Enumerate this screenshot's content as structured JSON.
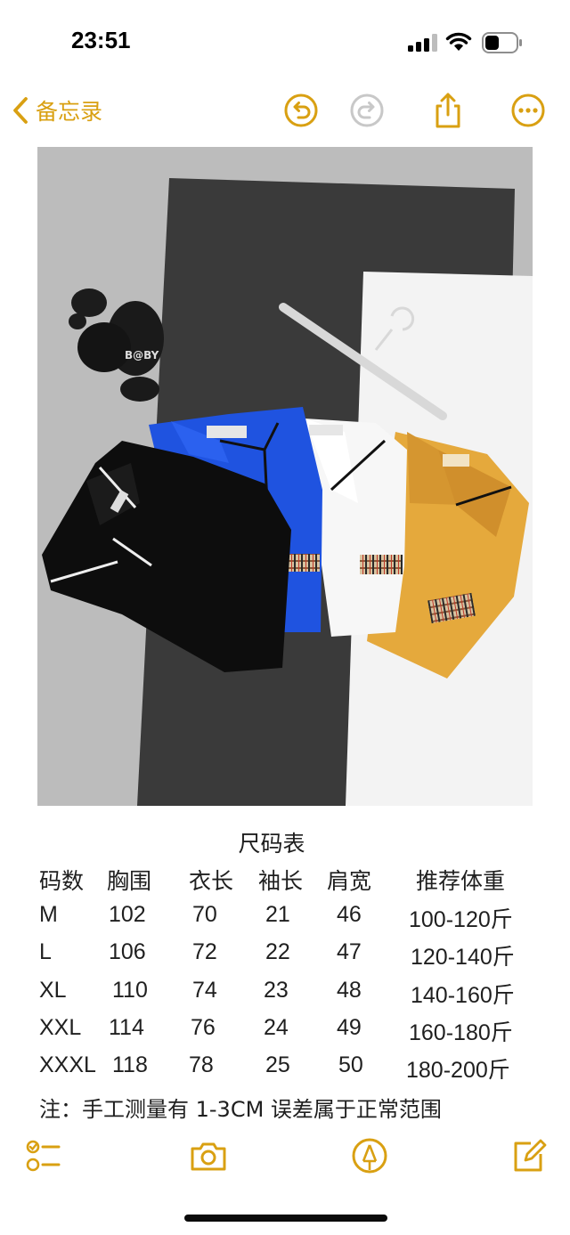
{
  "status_bar": {
    "time": "23:51"
  },
  "nav": {
    "back_label": "备忘录",
    "icons": [
      "undo-icon",
      "redo-icon",
      "share-icon",
      "more-icon"
    ]
  },
  "note": {
    "photo_icon": "product-photo",
    "size_chart": {
      "title": "尺码表",
      "columns": [
        "码数",
        "胸围",
        "衣长",
        "袖长",
        "肩宽",
        "推荐体重"
      ],
      "rows": [
        [
          "M",
          "102",
          "70",
          "21",
          "46",
          "100-120斤"
        ],
        [
          "L",
          "106",
          "72",
          "22",
          "47",
          "120-140斤"
        ],
        [
          "XL",
          "110",
          "74",
          "23",
          "48",
          "140-160斤"
        ],
        [
          "XXL",
          "114",
          "76",
          "24",
          "49",
          "160-180斤"
        ],
        [
          "XXXL",
          "118",
          "78",
          "25",
          "50",
          "180-200斤"
        ]
      ],
      "note": "注：手工测量有 1-3CM 误差属于正常范围"
    }
  },
  "toolbar": {
    "icons": [
      "checklist-icon",
      "camera-icon",
      "markup-icon",
      "compose-icon"
    ]
  },
  "colors": {
    "accent": "#d9a012",
    "polo_blue": "#1f53e0",
    "polo_yellow": "#e5a93c"
  }
}
